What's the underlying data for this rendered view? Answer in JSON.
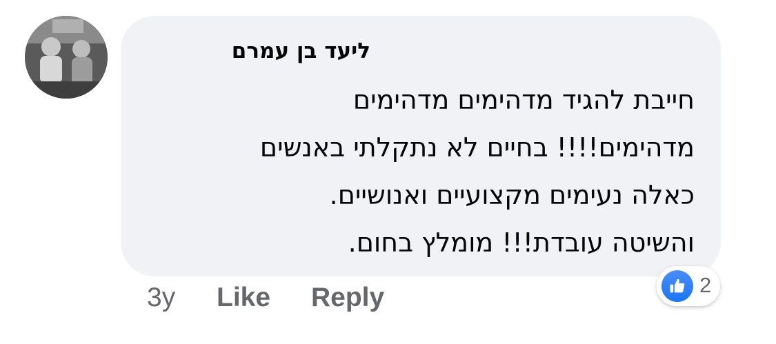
{
  "comment": {
    "author": "ליעד בן עמרם",
    "lines": [
      "חייבת להגיד מדהימים מדהימים",
      "מדהימים!!!! בחיים לא נתקלתי באנשים",
      "כאלה נעימים מקצועיים ואנושיים.",
      "והשיטה עובדת!!! מומלץ בחום."
    ],
    "reaction": {
      "icon": "like-thumb-icon",
      "color": "#1877f2",
      "count": "2"
    }
  },
  "actions": {
    "time": "3y",
    "like": "Like",
    "reply": "Reply"
  },
  "colors": {
    "bubble": "#f0f2f5",
    "meta_text": "#65676b",
    "body_text": "#050505"
  }
}
